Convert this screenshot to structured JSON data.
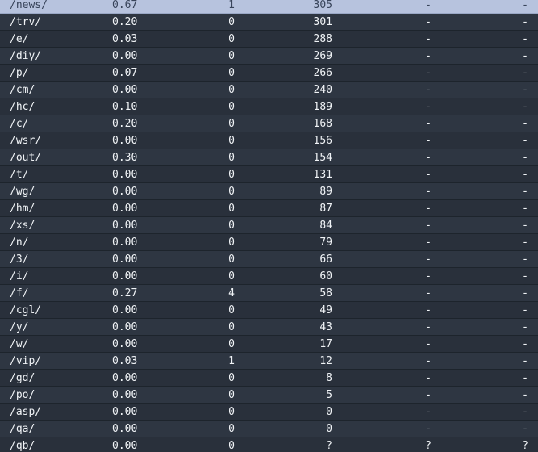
{
  "table": {
    "rows": [
      {
        "path": "/news/",
        "rate": "0.67",
        "hits": "1",
        "count": "305",
        "col5": "-",
        "col6": "-",
        "selected": true
      },
      {
        "path": "/trv/",
        "rate": "0.20",
        "hits": "0",
        "count": "301",
        "col5": "-",
        "col6": "-"
      },
      {
        "path": "/e/",
        "rate": "0.03",
        "hits": "0",
        "count": "288",
        "col5": "-",
        "col6": "-"
      },
      {
        "path": "/diy/",
        "rate": "0.00",
        "hits": "0",
        "count": "269",
        "col5": "-",
        "col6": "-"
      },
      {
        "path": "/p/",
        "rate": "0.07",
        "hits": "0",
        "count": "266",
        "col5": "-",
        "col6": "-"
      },
      {
        "path": "/cm/",
        "rate": "0.00",
        "hits": "0",
        "count": "240",
        "col5": "-",
        "col6": "-"
      },
      {
        "path": "/hc/",
        "rate": "0.10",
        "hits": "0",
        "count": "189",
        "col5": "-",
        "col6": "-"
      },
      {
        "path": "/c/",
        "rate": "0.20",
        "hits": "0",
        "count": "168",
        "col5": "-",
        "col6": "-"
      },
      {
        "path": "/wsr/",
        "rate": "0.00",
        "hits": "0",
        "count": "156",
        "col5": "-",
        "col6": "-"
      },
      {
        "path": "/out/",
        "rate": "0.30",
        "hits": "0",
        "count": "154",
        "col5": "-",
        "col6": "-"
      },
      {
        "path": "/t/",
        "rate": "0.00",
        "hits": "0",
        "count": "131",
        "col5": "-",
        "col6": "-"
      },
      {
        "path": "/wg/",
        "rate": "0.00",
        "hits": "0",
        "count": "89",
        "col5": "-",
        "col6": "-"
      },
      {
        "path": "/hm/",
        "rate": "0.00",
        "hits": "0",
        "count": "87",
        "col5": "-",
        "col6": "-"
      },
      {
        "path": "/xs/",
        "rate": "0.00",
        "hits": "0",
        "count": "84",
        "col5": "-",
        "col6": "-"
      },
      {
        "path": "/n/",
        "rate": "0.00",
        "hits": "0",
        "count": "79",
        "col5": "-",
        "col6": "-"
      },
      {
        "path": "/3/",
        "rate": "0.00",
        "hits": "0",
        "count": "66",
        "col5": "-",
        "col6": "-"
      },
      {
        "path": "/i/",
        "rate": "0.00",
        "hits": "0",
        "count": "60",
        "col5": "-",
        "col6": "-"
      },
      {
        "path": "/f/",
        "rate": "0.27",
        "hits": "4",
        "count": "58",
        "col5": "-",
        "col6": "-"
      },
      {
        "path": "/cgl/",
        "rate": "0.00",
        "hits": "0",
        "count": "49",
        "col5": "-",
        "col6": "-"
      },
      {
        "path": "/y/",
        "rate": "0.00",
        "hits": "0",
        "count": "43",
        "col5": "-",
        "col6": "-"
      },
      {
        "path": "/w/",
        "rate": "0.00",
        "hits": "0",
        "count": "17",
        "col5": "-",
        "col6": "-"
      },
      {
        "path": "/vip/",
        "rate": "0.03",
        "hits": "1",
        "count": "12",
        "col5": "-",
        "col6": "-"
      },
      {
        "path": "/gd/",
        "rate": "0.00",
        "hits": "0",
        "count": "8",
        "col5": "-",
        "col6": "-"
      },
      {
        "path": "/po/",
        "rate": "0.00",
        "hits": "0",
        "count": "5",
        "col5": "-",
        "col6": "-"
      },
      {
        "path": "/asp/",
        "rate": "0.00",
        "hits": "0",
        "count": "0",
        "col5": "-",
        "col6": "-"
      },
      {
        "path": "/qa/",
        "rate": "0.00",
        "hits": "0",
        "count": "0",
        "col5": "-",
        "col6": "-"
      },
      {
        "path": "/qb/",
        "rate": "0.00",
        "hits": "0",
        "count": "?",
        "col5": "?",
        "col6": "?"
      }
    ]
  }
}
